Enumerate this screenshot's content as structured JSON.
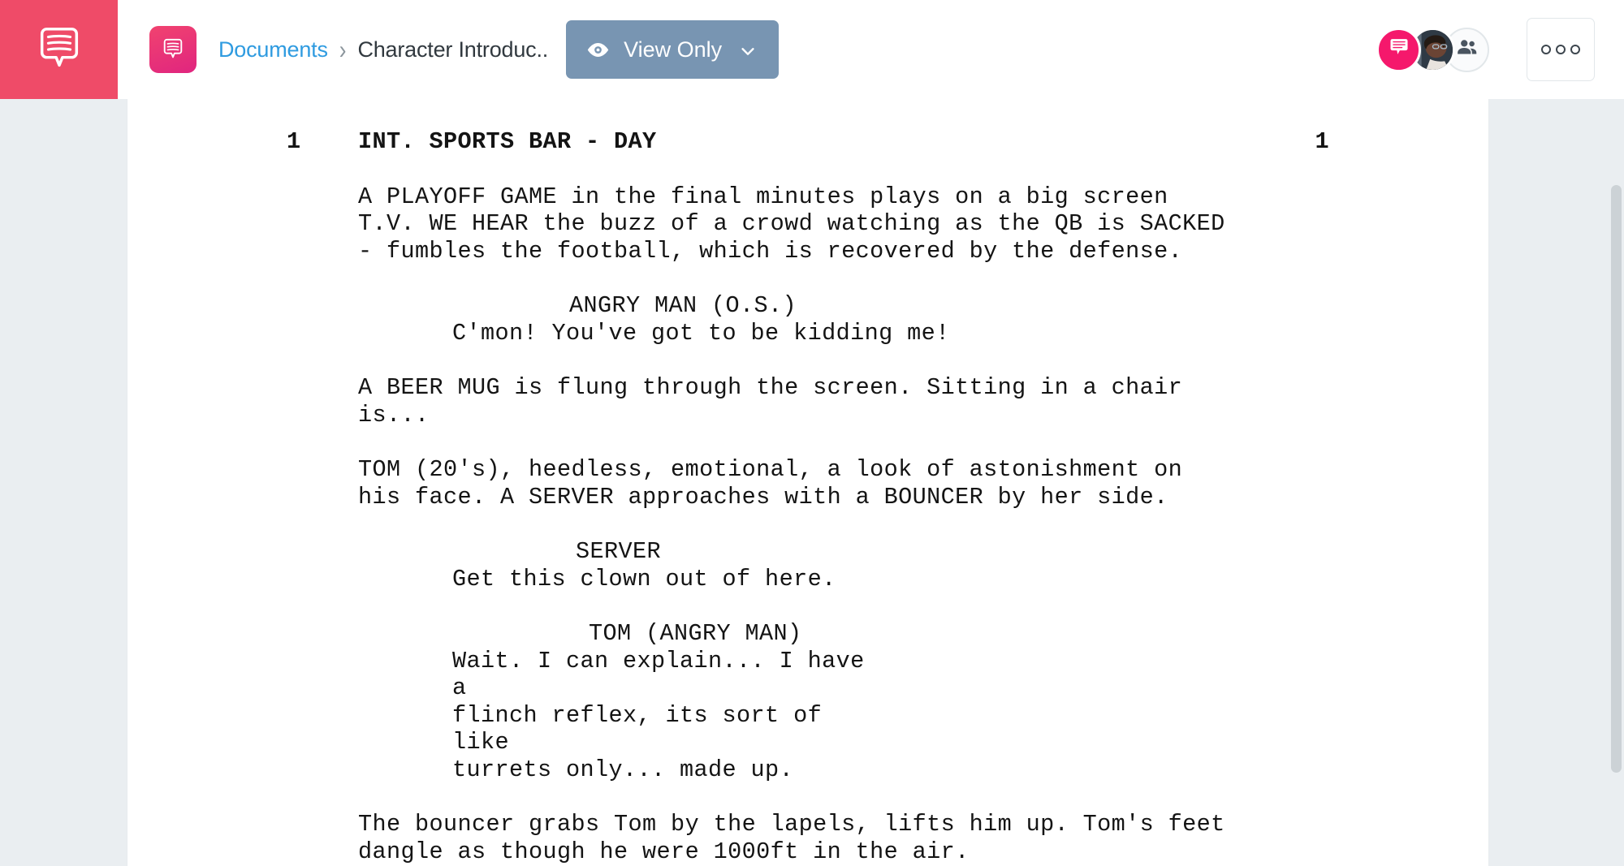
{
  "app": {
    "logo_icon": "script-bubble-logo-icon",
    "brand_color": "#ef4b68"
  },
  "header": {
    "doc_badge_icon": "document-bubble-icon",
    "breadcrumb": {
      "root_label": "Documents",
      "separator": "›",
      "current_label": "Character Introduc.."
    },
    "view_mode": {
      "label": "View Only",
      "eye_icon": "eye-icon",
      "chevron_icon": "chevron-down-icon",
      "color": "#7895b2"
    },
    "avatars": {
      "chat_icon": "chat-bubble-icon",
      "chat_color": "#f5186c",
      "photo_label": "user-avatar-photo",
      "people_icon": "people-icon"
    },
    "more_button": {
      "icon": "three-dots-icon",
      "dots": 3
    }
  },
  "document": {
    "page_number_left": "1",
    "page_number_right": "1",
    "scene_heading": "INT. SPORTS BAR - DAY",
    "blocks": [
      {
        "type": "action",
        "text": "A PLAYOFF GAME in the final minutes plays on a big screen\nT.V. WE HEAR the buzz of a crowd watching as the QB is SACKED\n- fumbles the football, which is recovered by the defense."
      },
      {
        "type": "dialogue",
        "character": "ANGRY MAN (O.S.)",
        "lines": "C'mon! You've got to be kidding me!"
      },
      {
        "type": "action",
        "text": "A BEER MUG is flung through the screen. Sitting in a chair\nis..."
      },
      {
        "type": "action",
        "text": "TOM (20's), heedless, emotional, a look of astonishment on\nhis face. A SERVER approaches with a BOUNCER by her side."
      },
      {
        "type": "dialogue",
        "character": "SERVER",
        "lines": "Get this clown out of here."
      },
      {
        "type": "dialogue",
        "character": "TOM (ANGRY MAN)",
        "lines": "Wait. I can explain... I have a\nflinch reflex, its sort of like\nturrets only... made up."
      },
      {
        "type": "action",
        "text": "The bouncer grabs Tom by the lapels, lifts him up. Tom's feet\ndangle as though he were 1000ft in the air."
      }
    ]
  },
  "scrollbar": {
    "orientation": "vertical"
  }
}
